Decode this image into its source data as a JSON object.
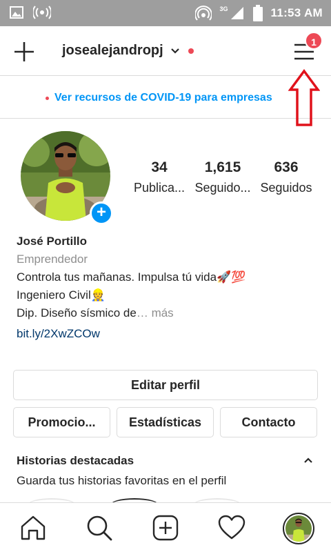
{
  "status_bar": {
    "time": "11:53 AM",
    "network": "3G",
    "icons": [
      "image-icon",
      "radio-icon",
      "hotspot-icon",
      "signal-icon",
      "battery-icon"
    ]
  },
  "header": {
    "username": "josealejandropj",
    "menu_badge": "1"
  },
  "covid_link": "Ver recursos de COVID-19 para empresas",
  "stats": {
    "posts": {
      "value": "34",
      "label": "Publica..."
    },
    "followers": {
      "value": "1,615",
      "label": "Seguido..."
    },
    "following": {
      "value": "636",
      "label": "Seguidos"
    }
  },
  "bio": {
    "name": "José Portillo",
    "category": "Emprendedor",
    "line1": "Controla tus mañanas. Impulsa tú vida🚀💯",
    "line2": "Ingeniero Civil👷",
    "line3": "Dip. Diseño sísmico de",
    "more": "… más",
    "link": "bit.ly/2XwZCOw"
  },
  "buttons": {
    "edit_profile": "Editar perfil",
    "promotions": "Promocio...",
    "statistics": "Estadísticas",
    "contact": "Contacto"
  },
  "highlights": {
    "title": "Historias destacadas",
    "subtitle": "Guarda tus historias favoritas en el perfil"
  },
  "bottom_nav": [
    "home-icon",
    "search-icon",
    "add-post-icon",
    "heart-icon",
    "profile-avatar"
  ],
  "colors": {
    "accent_blue": "#0095f6",
    "badge_red": "#ed4956",
    "annotation_red": "#e0121b",
    "status_bar_gray": "#9e9e9e"
  }
}
